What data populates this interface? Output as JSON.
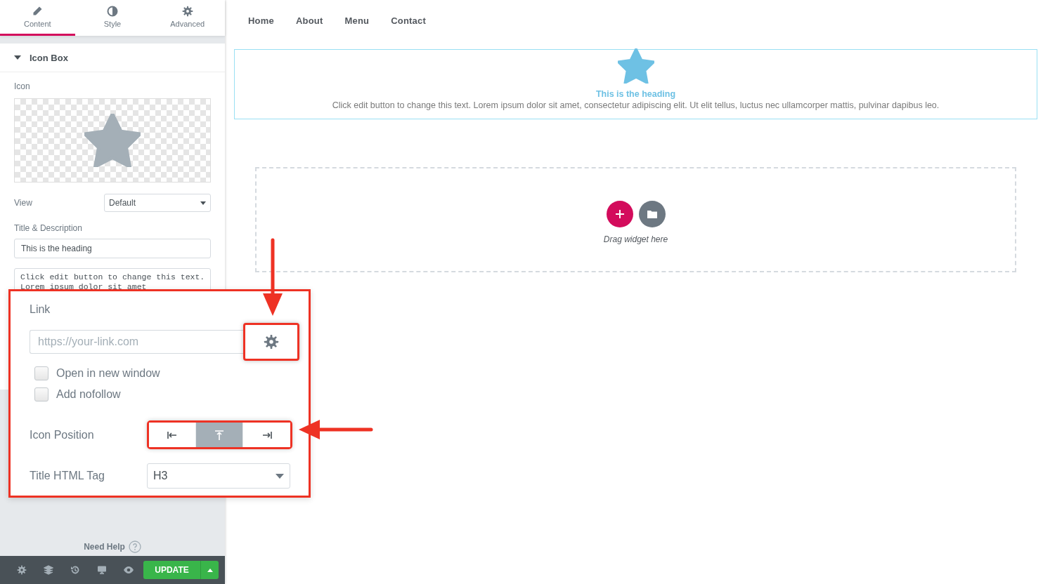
{
  "panel_tabs": [
    {
      "label": "Content",
      "kind": "pencil",
      "selected": true
    },
    {
      "label": "Style",
      "kind": "contrast",
      "selected": false
    },
    {
      "label": "Advanced",
      "kind": "gear",
      "selected": false
    }
  ],
  "section": {
    "title": "Icon Box",
    "expanded": true
  },
  "icon_label": "Icon",
  "view": {
    "label": "View",
    "value": "Default"
  },
  "title_description": {
    "label": "Title & Description",
    "title_value": "This is the heading",
    "description_lines": [
      "Click edit button to change this text.",
      "Lorem ipsum dolor sit amet"
    ]
  },
  "link_popup": {
    "label": "Link",
    "placeholder": "https://your-link.com",
    "options": [
      {
        "label": "Open in new window",
        "checked": false
      },
      {
        "label": "Add nofollow",
        "checked": false
      }
    ],
    "icon_position": {
      "label": "Icon Position",
      "options": [
        {
          "kind": "left",
          "selected": false
        },
        {
          "kind": "top",
          "selected": true
        },
        {
          "kind": "right",
          "selected": false
        }
      ]
    },
    "title_tag": {
      "label": "Title HTML Tag",
      "value": "H3"
    }
  },
  "need_help": "Need Help",
  "footer": {
    "update_button": "UPDATE"
  },
  "nav": [
    "Home",
    "About",
    "Menu",
    "Contact"
  ],
  "icon_box": {
    "heading": "This is the heading",
    "text": "Click edit button to change this text. Lorem ipsum dolor sit amet, consectetur adipiscing elit. Ut elit tellus, luctus nec ullamcorper mattis, pulvinar dapibus leo."
  },
  "drop_zone": {
    "hint": "Drag widget here"
  }
}
